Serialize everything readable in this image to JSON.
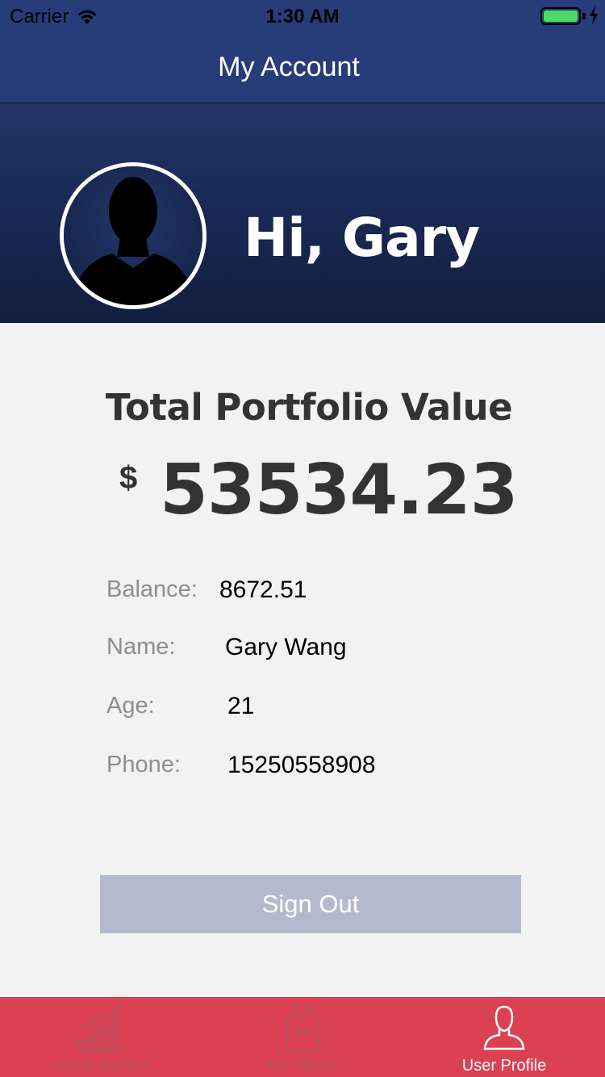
{
  "status_bar": {
    "carrier": "Carrier",
    "time": "1:30 AM"
  },
  "nav": {
    "title": "My Account"
  },
  "header": {
    "greeting": "Hi, Gary"
  },
  "portfolio": {
    "label": "Total Portfolio Value",
    "currency": "$",
    "value": "53534.23"
  },
  "info": {
    "balance": {
      "label": "Balance:",
      "value": "8672.51"
    },
    "name": {
      "label": "Name:",
      "value": "Gary Wang"
    },
    "age": {
      "label": "Age:",
      "value": "21"
    },
    "phone": {
      "label": "Phone:",
      "value": "15250558908"
    }
  },
  "actions": {
    "sign_out": "Sign Out"
  },
  "tabs": [
    {
      "label": "Stock Market",
      "icon": "bar-chart-icon"
    },
    {
      "label": "My Player",
      "icon": "jersey-icon",
      "jersey_number": "23"
    },
    {
      "label": "User Profile",
      "icon": "user-icon"
    }
  ],
  "colors": {
    "nav_background": "#263d7a",
    "tab_bar": "#db4053",
    "sign_out_button": "#b4bace",
    "battery": "#4cd964"
  }
}
